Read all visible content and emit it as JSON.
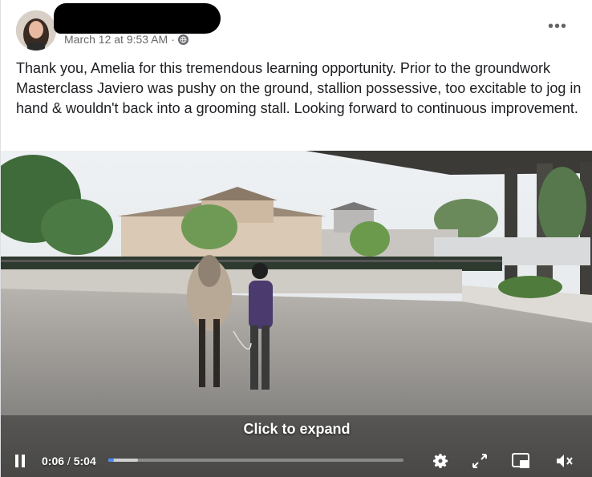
{
  "post": {
    "timestamp": "March 12 at 9:53 AM",
    "separator": "·",
    "more_label": "•••",
    "body": "Thank you, Amelia for this tremendous learning opportunity. Prior to the groundwork Masterclass Javiero was pushy on the ground, stallion possessive, too excitable to jog in hand & wouldn't back into a grooming stall. Looking forward to continuous improvement."
  },
  "video": {
    "expand_label": "Click to expand",
    "current_time": "0:06",
    "time_separator": " / ",
    "duration": "5:04",
    "progress_fraction": 0.02,
    "buffered_fraction": 0.1,
    "accent": "#4a8cff"
  },
  "icons": {
    "audience": "globe-icon",
    "play_state": "pause-icon",
    "settings": "gear-icon",
    "fullscreen": "expand-icon",
    "pip": "picture-in-picture-icon",
    "volume": "volume-muted-icon"
  }
}
